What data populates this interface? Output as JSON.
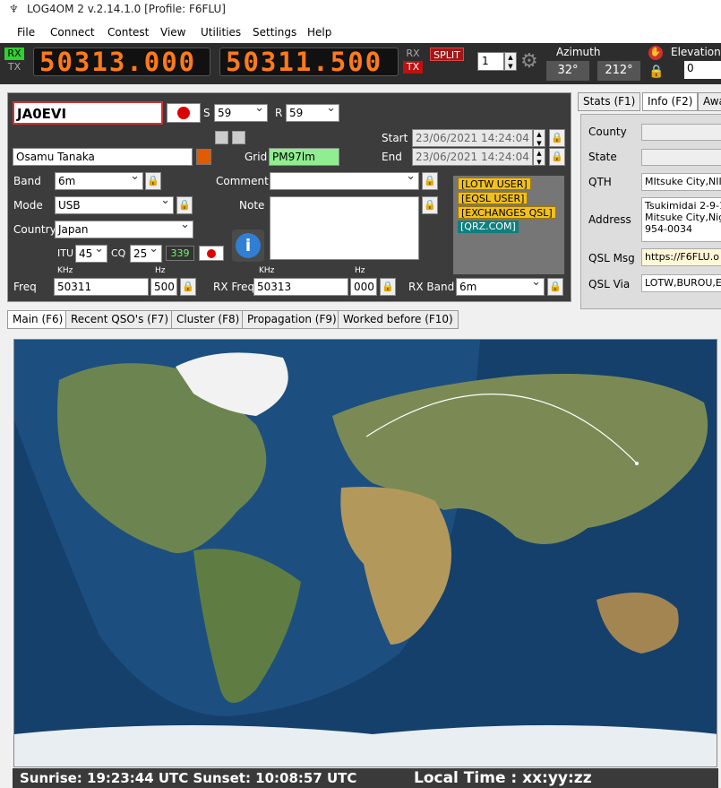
{
  "window": {
    "title": "LOG4OM 2 v.2.14.1.0 [Profile: F6FLU]"
  },
  "menu": [
    "File",
    "Connect",
    "Contest",
    "View",
    "Utilities",
    "Settings",
    "Help"
  ],
  "radio": {
    "rx_label": "RX",
    "tx_label": "TX",
    "freq_tx": "50313.000",
    "freq_rx": "50311.500",
    "rx2_label": "RX",
    "tx2_label": "TX",
    "split_label": "SPLIT",
    "vfo_value": "1",
    "azimuth_label": "Azimuth",
    "azimuth_short": "32°",
    "azimuth_long": "212°",
    "elevation_label": "Elevation",
    "elevation_value": "0"
  },
  "qso": {
    "callsign": "JA0EVI",
    "s_label": "S",
    "s_value": "59",
    "r_label": "R",
    "r_value": "59",
    "name": "Osamu Tanaka",
    "grid_label": "Grid",
    "grid_value": "PM97lm",
    "start_label": "Start",
    "start_value": "23/06/2021 14:24:04",
    "end_label": "End",
    "end_value": "23/06/2021 14:24:04",
    "band_label": "Band",
    "band_value": "6m",
    "comment_label": "Comment",
    "mode_label": "Mode",
    "mode_value": "USB",
    "note_label": "Note",
    "country_label": "Country",
    "country_value": "Japan",
    "itu_label": "ITU",
    "itu_value": "45",
    "cq_label": "CQ",
    "cq_value": "25",
    "dxcc_value": "339",
    "freq_label": "Freq",
    "freq_khz_unit": "KHz",
    "freq_hz_unit": "Hz",
    "freq_khz": "50311",
    "freq_hz": "500",
    "rxfreq_label": "RX Freq",
    "rxfreq_khz_unit": "KHz",
    "rxfreq_hz_unit": "Hz",
    "rxfreq_khz": "50313",
    "rxfreq_hz": "000",
    "rxband_label": "RX Band",
    "rxband_value": "6m",
    "badges": [
      "[LOTW USER]",
      "[EQSL USER]",
      "[EXCHANGES QSL]",
      "[QRZ.COM]"
    ]
  },
  "right": {
    "tabs": [
      "Stats (F1)",
      "Info (F2)",
      "Awa"
    ],
    "fields": [
      {
        "label": "County",
        "value": ""
      },
      {
        "label": "State",
        "value": ""
      },
      {
        "label": "QTH",
        "value": "MItsuke City,NII"
      },
      {
        "label": "Address",
        "value": "Tsukimidai 2-9-1\nMitsuke City,Nig\n954-0034"
      },
      {
        "label": "QSL Msg",
        "value": "https://F6FLU.o"
      },
      {
        "label": "QSL Via",
        "value": "LOTW,BUROU,E"
      }
    ]
  },
  "bottom_tabs": [
    "Main (F6)",
    "Recent QSO's (F7)",
    "Cluster (F8)",
    "Propagation (F9)",
    "Worked before (F10)"
  ],
  "status": {
    "sun": "Sunrise: 19:23:44 UTC  Sunset: 10:08:57 UTC",
    "local": "Local Time : xx:yy:zz"
  },
  "colors": {
    "radio_bg": "#2d2d2d",
    "freq_digits": "#ff7a1a",
    "split_bg": "#a01818",
    "panel_bg": "#3c3c3c",
    "grid_bg": "#90ee90",
    "badge_yellow": "#f0c020",
    "badge_teal": "#0f7f7f",
    "ocean": "#1b4b79"
  },
  "icons": [
    "log4om-icon",
    "gear-icon",
    "lock-icon",
    "info-icon",
    "japan-flag-icon",
    "elevation-stop-icon"
  ]
}
